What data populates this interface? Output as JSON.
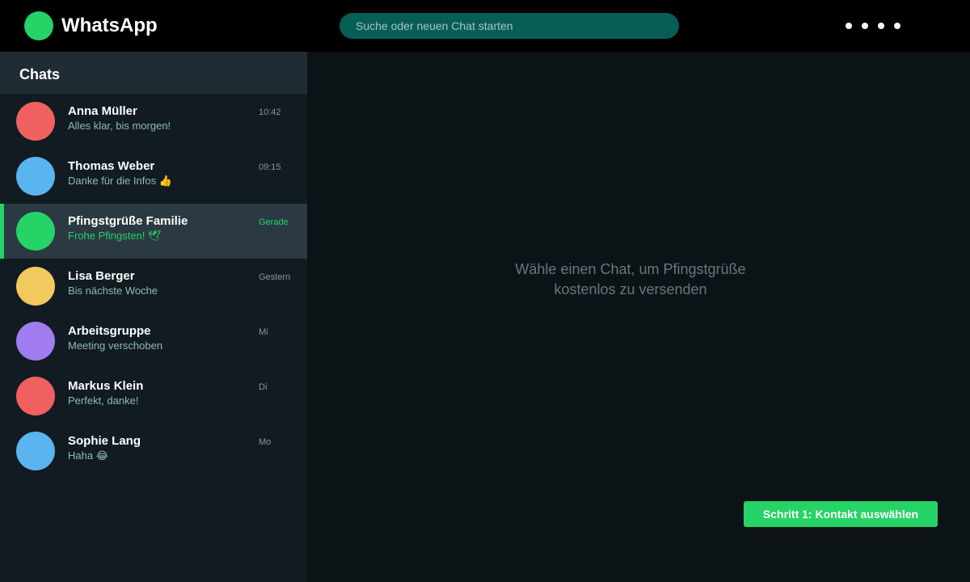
{
  "app": {
    "title": "WhatsApp",
    "brand_color": "#25d366"
  },
  "search": {
    "placeholder": "Suche oder neuen Chat starten",
    "value": ""
  },
  "header": {
    "menu_icon": "more-dots-icon"
  },
  "sidebar": {
    "title": "Chats",
    "chats": [
      {
        "name": "Anna Müller",
        "preview": "Alles klar, bis morgen!",
        "time": "10:42",
        "avatar_color": "#f06060",
        "active": false
      },
      {
        "name": "Thomas Weber",
        "preview": "Danke für die Infos 👍",
        "time": "09:15",
        "avatar_color": "#5ab4f0",
        "active": false
      },
      {
        "name": "Pfingstgrüße Familie",
        "preview": "Frohe Pfingsten! 🕊",
        "time": "Gerade",
        "avatar_color": "#25d366",
        "active": true
      },
      {
        "name": "Lisa Berger",
        "preview": "Bis nächste Woche",
        "time": "Gestern",
        "avatar_color": "#f2c95f",
        "active": false
      },
      {
        "name": "Arbeitsgruppe",
        "preview": "Meeting verschoben",
        "time": "Mi",
        "avatar_color": "#a07cf0",
        "active": false
      },
      {
        "name": "Markus Klein",
        "preview": "Perfekt, danke!",
        "time": "Di",
        "avatar_color": "#f06060",
        "active": false
      },
      {
        "name": "Sophie Lang",
        "preview": "Haha 😂",
        "time": "Mo",
        "avatar_color": "#5ab4f0",
        "active": false
      }
    ]
  },
  "main": {
    "empty_line1": "Wähle einen Chat, um Pfingstgrüße",
    "empty_line2": "kostenlos zu versenden",
    "step_button": "Schritt 1: Kontakt auswählen"
  }
}
